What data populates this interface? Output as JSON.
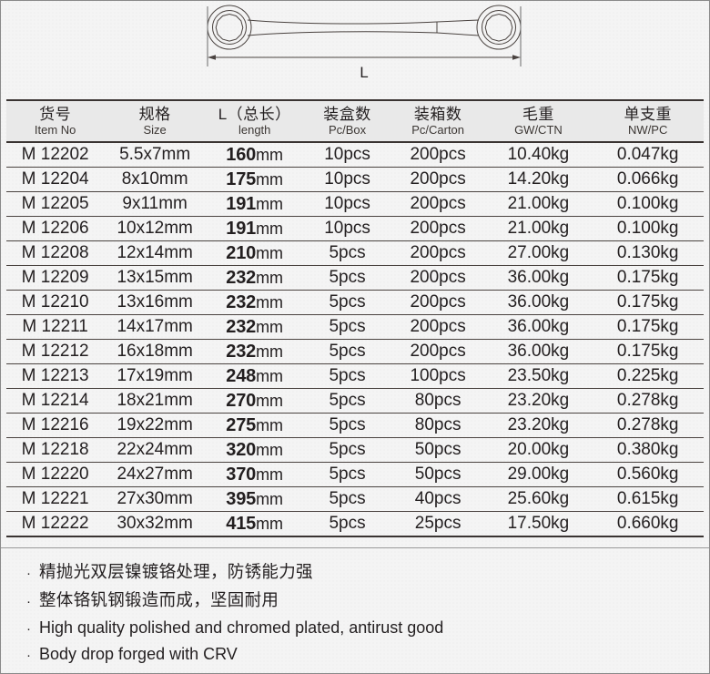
{
  "drawing": {
    "dimension_label": "L",
    "product_name": "double-ring-ratcheting-wrench"
  },
  "table": {
    "columns": [
      {
        "cn": "货号",
        "en": "Item No"
      },
      {
        "cn": "规格",
        "en": "Size"
      },
      {
        "cn": "L（总长）",
        "en": "length"
      },
      {
        "cn": "装盒数",
        "en": "Pc/Box"
      },
      {
        "cn": "装箱数",
        "en": "Pc/Carton"
      },
      {
        "cn": "毛重",
        "en": "GW/CTN"
      },
      {
        "cn": "单支重",
        "en": "NW/PC"
      }
    ],
    "rows": [
      {
        "item": "M 12202",
        "size": "5.5x7mm",
        "len_num": "160",
        "len_unit": "mm",
        "box": "10pcs",
        "carton": "200pcs",
        "gw": "10.40kg",
        "nw": "0.047kg"
      },
      {
        "item": "M 12204",
        "size": "8x10mm",
        "len_num": "175",
        "len_unit": "mm",
        "box": "10pcs",
        "carton": "200pcs",
        "gw": "14.20kg",
        "nw": "0.066kg"
      },
      {
        "item": "M 12205",
        "size": "9x11mm",
        "len_num": "191",
        "len_unit": "mm",
        "box": "10pcs",
        "carton": "200pcs",
        "gw": "21.00kg",
        "nw": "0.100kg"
      },
      {
        "item": "M 12206",
        "size": "10x12mm",
        "len_num": "191",
        "len_unit": "mm",
        "box": "10pcs",
        "carton": "200pcs",
        "gw": "21.00kg",
        "nw": "0.100kg"
      },
      {
        "item": "M 12208",
        "size": "12x14mm",
        "len_num": "210",
        "len_unit": "mm",
        "box": "5pcs",
        "carton": "200pcs",
        "gw": "27.00kg",
        "nw": "0.130kg"
      },
      {
        "item": "M 12209",
        "size": "13x15mm",
        "len_num": "232",
        "len_unit": "mm",
        "box": "5pcs",
        "carton": "200pcs",
        "gw": "36.00kg",
        "nw": "0.175kg"
      },
      {
        "item": "M 12210",
        "size": "13x16mm",
        "len_num": "232",
        "len_unit": "mm",
        "box": "5pcs",
        "carton": "200pcs",
        "gw": "36.00kg",
        "nw": "0.175kg"
      },
      {
        "item": "M 12211",
        "size": "14x17mm",
        "len_num": "232",
        "len_unit": "mm",
        "box": "5pcs",
        "carton": "200pcs",
        "gw": "36.00kg",
        "nw": "0.175kg"
      },
      {
        "item": "M 12212",
        "size": "16x18mm",
        "len_num": "232",
        "len_unit": "mm",
        "box": "5pcs",
        "carton": "200pcs",
        "gw": "36.00kg",
        "nw": "0.175kg"
      },
      {
        "item": "M 12213",
        "size": "17x19mm",
        "len_num": "248",
        "len_unit": "mm",
        "box": "5pcs",
        "carton": "100pcs",
        "gw": "23.50kg",
        "nw": "0.225kg"
      },
      {
        "item": "M 12214",
        "size": "18x21mm",
        "len_num": "270",
        "len_unit": "mm",
        "box": "5pcs",
        "carton": "80pcs",
        "gw": "23.20kg",
        "nw": "0.278kg"
      },
      {
        "item": "M 12216",
        "size": "19x22mm",
        "len_num": "275",
        "len_unit": "mm",
        "box": "5pcs",
        "carton": "80pcs",
        "gw": "23.20kg",
        "nw": "0.278kg"
      },
      {
        "item": "M 12218",
        "size": "22x24mm",
        "len_num": "320",
        "len_unit": "mm",
        "box": "5pcs",
        "carton": "50pcs",
        "gw": "20.00kg",
        "nw": "0.380kg"
      },
      {
        "item": "M 12220",
        "size": "24x27mm",
        "len_num": "370",
        "len_unit": "mm",
        "box": "5pcs",
        "carton": "50pcs",
        "gw": "29.00kg",
        "nw": "0.560kg"
      },
      {
        "item": "M 12221",
        "size": "27x30mm",
        "len_num": "395",
        "len_unit": "mm",
        "box": "5pcs",
        "carton": "40pcs",
        "gw": "25.60kg",
        "nw": "0.615kg"
      },
      {
        "item": "M 12222",
        "size": "30x32mm",
        "len_num": "415",
        "len_unit": "mm",
        "box": "5pcs",
        "carton": "25pcs",
        "gw": "17.50kg",
        "nw": "0.660kg"
      }
    ]
  },
  "features": {
    "bullet": "·",
    "items": [
      {
        "text": "精抛光双层镍镀铬处理，防锈能力强",
        "lang": "cn"
      },
      {
        "text": "整体铬钒钢锻造而成，坚固耐用",
        "lang": "cn"
      },
      {
        "text": "High quality polished and chromed plated, antirust good",
        "lang": "en"
      },
      {
        "text": "Body drop forged with CRV",
        "lang": "en"
      }
    ]
  },
  "colors": {
    "rule": "#3a3432",
    "header_band": "#e9e9e9",
    "text": "#231f20",
    "page_bg": "#f4f4f4"
  }
}
